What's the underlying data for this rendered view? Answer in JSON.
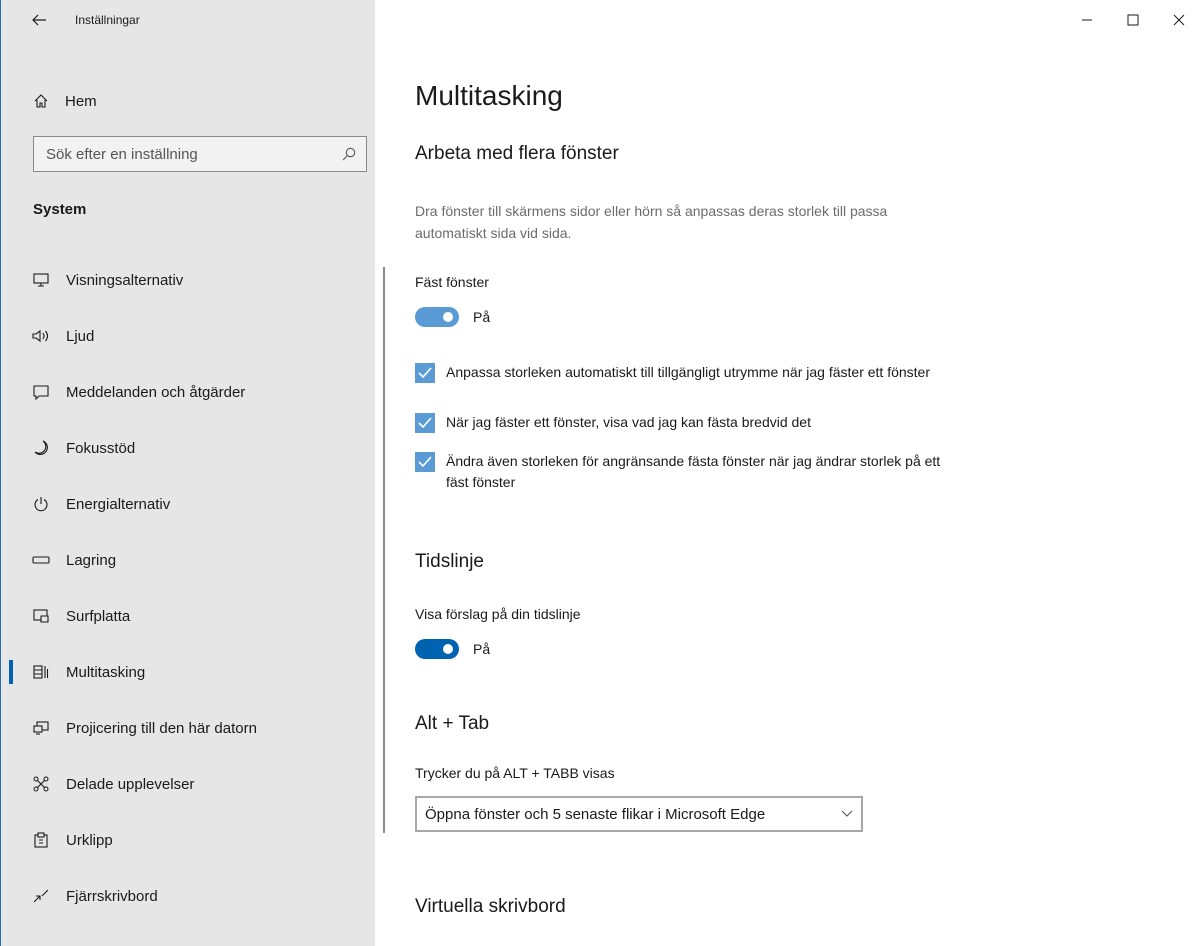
{
  "app": {
    "title": "Inställningar"
  },
  "sidebar": {
    "home_label": "Hem",
    "search_placeholder": "Sök efter en inställning",
    "section_label": "System",
    "items": [
      {
        "label": "Visningsalternativ",
        "icon": "display-icon"
      },
      {
        "label": "Ljud",
        "icon": "speaker-icon"
      },
      {
        "label": "Meddelanden och åtgärder",
        "icon": "message-icon"
      },
      {
        "label": "Fokusstöd",
        "icon": "moon-icon"
      },
      {
        "label": "Energialternativ",
        "icon": "power-icon"
      },
      {
        "label": "Lagring",
        "icon": "storage-icon"
      },
      {
        "label": "Surfplatta",
        "icon": "tablet-icon"
      },
      {
        "label": "Multitasking",
        "icon": "multitasking-icon",
        "active": true
      },
      {
        "label": "Projicering till den här datorn",
        "icon": "projection-icon"
      },
      {
        "label": "Delade upplevelser",
        "icon": "shared-experiences-icon"
      },
      {
        "label": "Urklipp",
        "icon": "clipboard-icon"
      },
      {
        "label": "Fjärrskrivbord",
        "icon": "remote-desktop-icon"
      }
    ]
  },
  "main": {
    "page_title": "Multitasking",
    "windows_section": {
      "heading": "Arbeta med flera fönster",
      "description": "Dra fönster till skärmens sidor eller hörn så anpassas deras storlek till passa automatiskt sida vid sida.",
      "snap_label": "Fäst fönster",
      "snap_state": "På",
      "checks": [
        {
          "label": "Anpassa storleken automatiskt till tillgängligt utrymme när jag fäster ett fönster",
          "checked": true
        },
        {
          "label": "När jag fäster ett fönster, visa vad jag kan fästa bredvid det",
          "checked": true
        },
        {
          "label": "Ändra även storleken för angränsande fästa fönster när jag ändrar storlek på ett fäst fönster",
          "checked": true
        }
      ]
    },
    "timeline_section": {
      "heading": "Tidslinje",
      "toggle_label": "Visa förslag på din tidslinje",
      "toggle_state": "På"
    },
    "alttab_section": {
      "heading": "Alt + Tab",
      "field_label": "Trycker du på ALT + TABB visas",
      "selected": "Öppna fönster och 5 senaste flikar i Microsoft Edge"
    },
    "virtual_section": {
      "heading": "Virtuella skrivbord"
    }
  },
  "colors": {
    "accent": "#0063b1",
    "accent_light": "#5b9bd5",
    "sidebar_bg": "#e6e6e6"
  }
}
